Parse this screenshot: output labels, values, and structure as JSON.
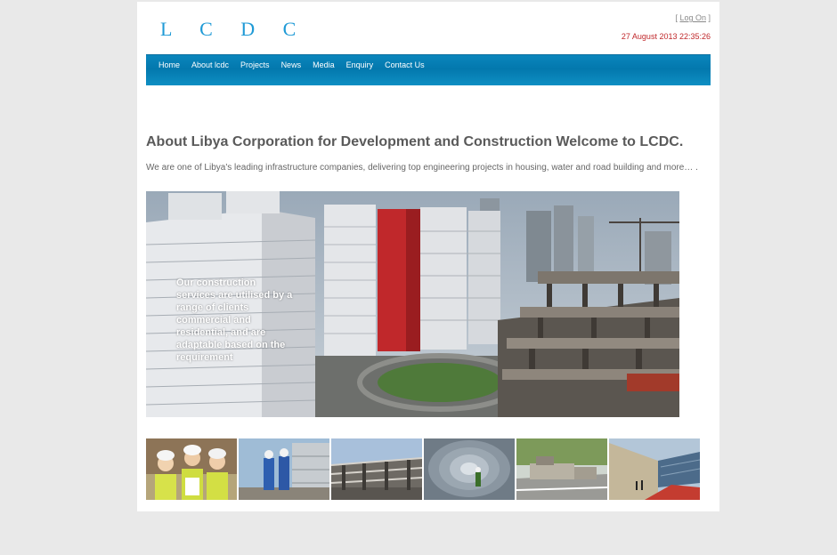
{
  "header": {
    "logo": "L C D C",
    "logon_open": "[ ",
    "logon_link": "Log On",
    "logon_close": " ]",
    "datetime": "27 August 2013 22:35:26"
  },
  "nav": {
    "items": [
      {
        "label": "Home"
      },
      {
        "label": "About lcdc"
      },
      {
        "label": "Projects"
      },
      {
        "label": "News"
      },
      {
        "label": "Media"
      },
      {
        "label": "Enquiry"
      },
      {
        "label": "Contact Us"
      }
    ]
  },
  "main": {
    "heading": "About Libya Corporation for Development and Construction Welcome to LCDC.",
    "intro": "We are one of Libya's leading infrastructure companies, delivering top engineering projects in housing, water and road building and more… .",
    "hero": {
      "caption": "Our construction services are utilised by a range of clients commercial and residential, and are adaptable based on the requirement"
    },
    "thumbnails": [
      {
        "subject": "workers-hardhats"
      },
      {
        "subject": "workers-site"
      },
      {
        "subject": "stadium-structure"
      },
      {
        "subject": "tunnel"
      },
      {
        "subject": "road-paving"
      },
      {
        "subject": "modern-building"
      }
    ]
  },
  "colors": {
    "logo": "#1f9ad6",
    "nav_bar": "#0378ad",
    "datetime": "#c0282b",
    "heading": "#5a5a5a"
  }
}
